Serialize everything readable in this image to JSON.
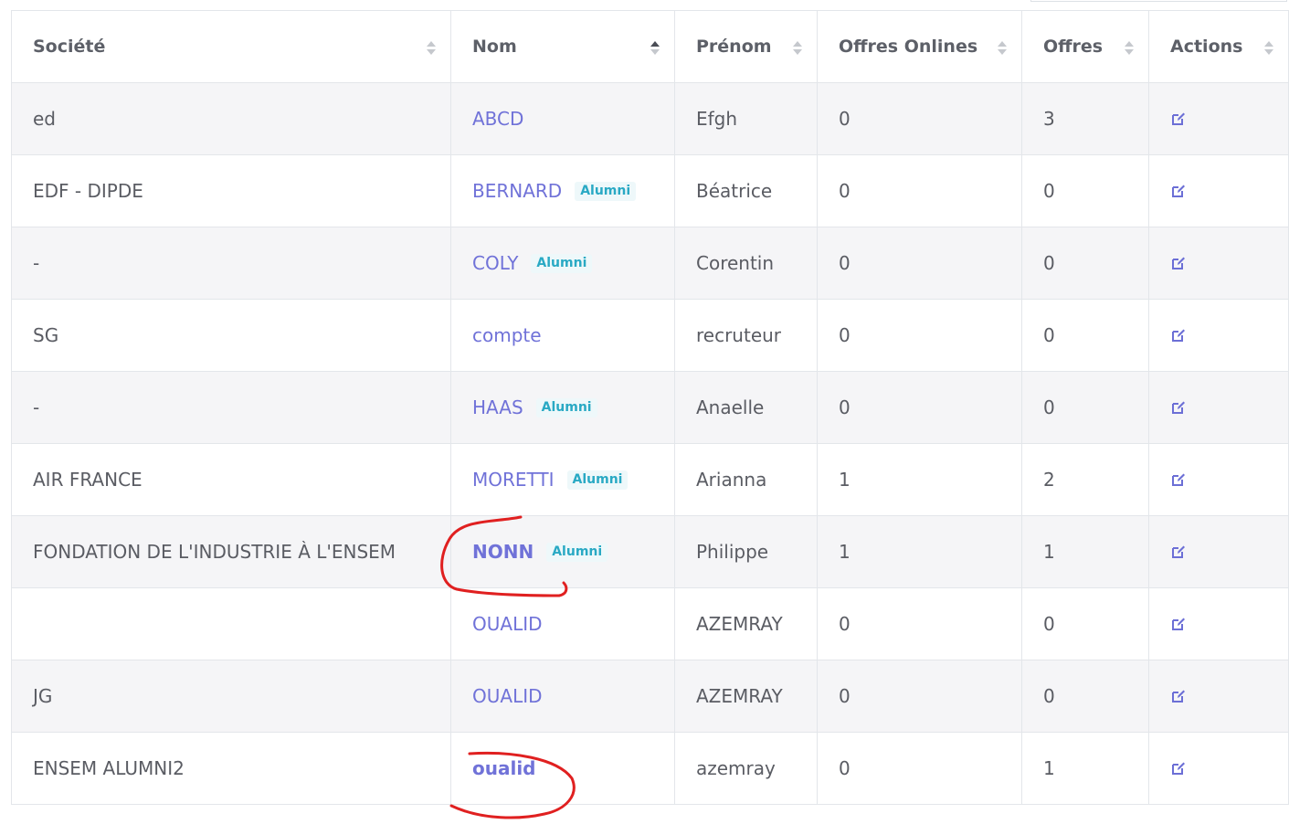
{
  "columns": [
    {
      "label": "Société",
      "sort": "none"
    },
    {
      "label": "Nom",
      "sort": "asc"
    },
    {
      "label": "Prénom",
      "sort": "none"
    },
    {
      "label": "Offres Onlines",
      "sort": "none"
    },
    {
      "label": "Offres",
      "sort": "none"
    },
    {
      "label": "Actions",
      "sort": "none"
    }
  ],
  "badge_label": "Alumni",
  "edit_icon": "edit-icon",
  "accent_color": "#7072d8",
  "badge_color": "#29a9c4",
  "annotation_color": "#e02020",
  "rows": [
    {
      "societe": "ed",
      "nom": "ABCD",
      "alumni": false,
      "prenom": "Efgh",
      "offres_onlines": "0",
      "offres": "3"
    },
    {
      "societe": "EDF - DIPDE",
      "nom": "BERNARD",
      "alumni": true,
      "prenom": "Béatrice",
      "offres_onlines": "0",
      "offres": "0"
    },
    {
      "societe": "-",
      "nom": "COLY",
      "alumni": true,
      "prenom": "Corentin",
      "offres_onlines": "0",
      "offres": "0"
    },
    {
      "societe": "SG",
      "nom": "compte",
      "alumni": false,
      "prenom": "recruteur",
      "offres_onlines": "0",
      "offres": "0"
    },
    {
      "societe": "-",
      "nom": "HAAS",
      "alumni": true,
      "prenom": "Anaelle",
      "offres_onlines": "0",
      "offres": "0"
    },
    {
      "societe": "AIR FRANCE",
      "nom": "MORETTI",
      "alumni": true,
      "prenom": "Arianna",
      "offres_onlines": "1",
      "offres": "2"
    },
    {
      "societe": "FONDATION DE L'INDUSTRIE À L'ENSEM",
      "nom": "NONN",
      "alumni": true,
      "bold": true,
      "prenom": "Philippe",
      "offres_onlines": "1",
      "offres": "1"
    },
    {
      "societe": "",
      "nom": "OUALID",
      "alumni": false,
      "prenom": "AZEMRAY",
      "offres_onlines": "0",
      "offres": "0"
    },
    {
      "societe": "JG",
      "nom": "OUALID",
      "alumni": false,
      "prenom": "AZEMRAY",
      "offres_onlines": "0",
      "offres": "0"
    },
    {
      "societe": "ENSEM ALUMNI2",
      "nom": "oualid",
      "alumni": false,
      "bold": true,
      "prenom": "azemray",
      "offres_onlines": "0",
      "offres": "1"
    }
  ]
}
